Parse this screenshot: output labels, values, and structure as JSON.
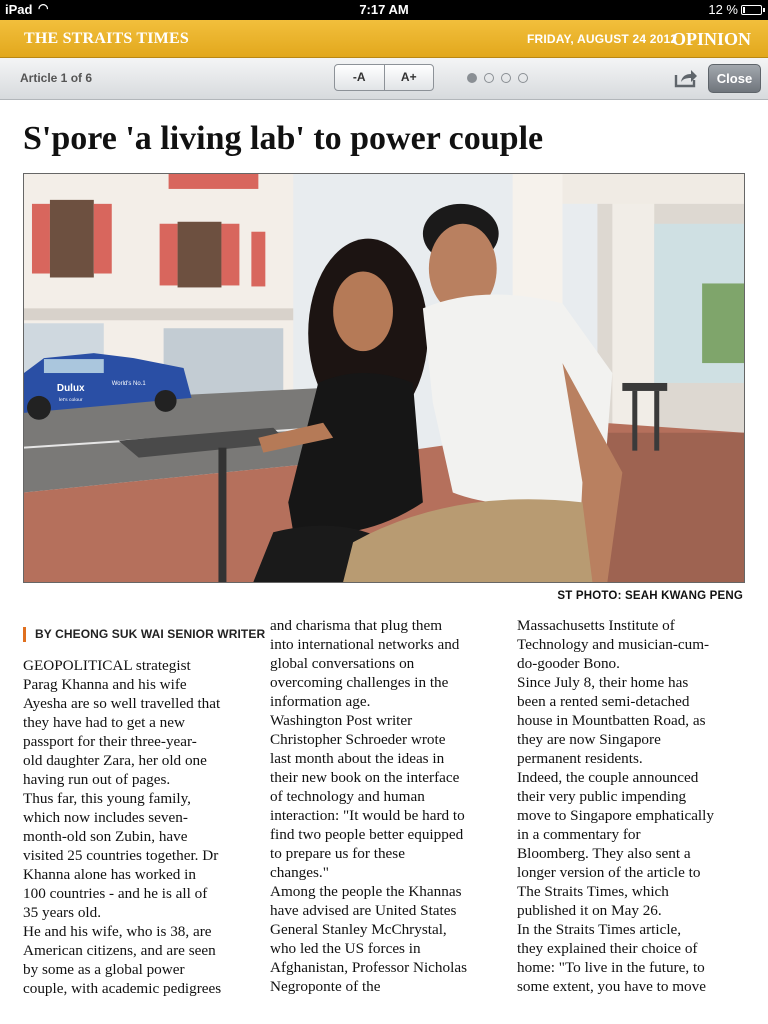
{
  "status_bar": {
    "device": "iPad",
    "time": "7:17 AM",
    "battery": "12 %"
  },
  "masthead": {
    "logo": "THE STRAITS TIMES",
    "date": "FRIDAY, AUGUST 24 2012",
    "section": "OPINION"
  },
  "toolbar": {
    "article_counter": "Article 1 of 6",
    "font_decrease": "-A",
    "font_increase": "A+",
    "pages": 4,
    "active_page": 1,
    "close_label": "Close"
  },
  "article": {
    "headline": "S'pore 'a living lab' to power couple",
    "photo_credit": "ST PHOTO: SEAH KWANG PENG",
    "byline": "BY CHEONG SUK WAI SENIOR WRITER",
    "col1_text": "GEOPOLITICAL strategist\nParag Khanna and his wife\nAyesha are so well travelled that\nthey have had to get a new\npassport for their three-year-\nold daughter Zara, her old one\nhaving run out of pages.\n Thus far, this young family,\nwhich now includes seven-\nmonth-old son Zubin, have\nvisited 25 countries together. Dr\nKhanna alone has worked in\n100 countries - and he is all of\n35 years old.\n He and his wife, who is 38, are\nAmerican citizens, and are seen\nby some as a global power\ncouple, with academic pedigrees",
    "col2_text": "and charisma that plug them\ninto international networks and\nglobal conversations on\novercoming challenges in the\ninformation age.\n Washington Post writer\nChristopher Schroeder wrote\nlast month about the ideas in\ntheir new book on the interface\nof technology and human\ninteraction: \"It would be hard to\nfind two people better equipped\nto prepare us for these\nchanges.\"\n Among the people the Khannas\nhave advised are United States\nGeneral Stanley McChrystal,\nwho led the US forces in\nAfghanistan, Professor Nicholas\nNegroponte of the",
    "col3_text": "Massachusetts Institute of\nTechnology and musician-cum-\ndo-gooder Bono.\n Since July 8, their home has\nbeen a rented semi-detached\nhouse in Mountbatten Road, as\nthey are now Singapore\npermanent residents.\n Indeed, the couple announced\ntheir very public impending\nmove to Singapore emphatically\nin a commentary for\nBloomberg. They also sent a\nlonger version of the article to\nThe Straits Times, which\npublished it on May 26.\n In the Straits Times article,\nthey explained their choice of\nhome: \"To live in the future, to\nsome extent, you have to move"
  },
  "photo_car_text": {
    "brand": "Dulux",
    "slogan": "World's No.1",
    "tagline": "let's colour"
  },
  "colors": {
    "masthead": "#e9b22a",
    "byline_accent": "#e0701f"
  }
}
